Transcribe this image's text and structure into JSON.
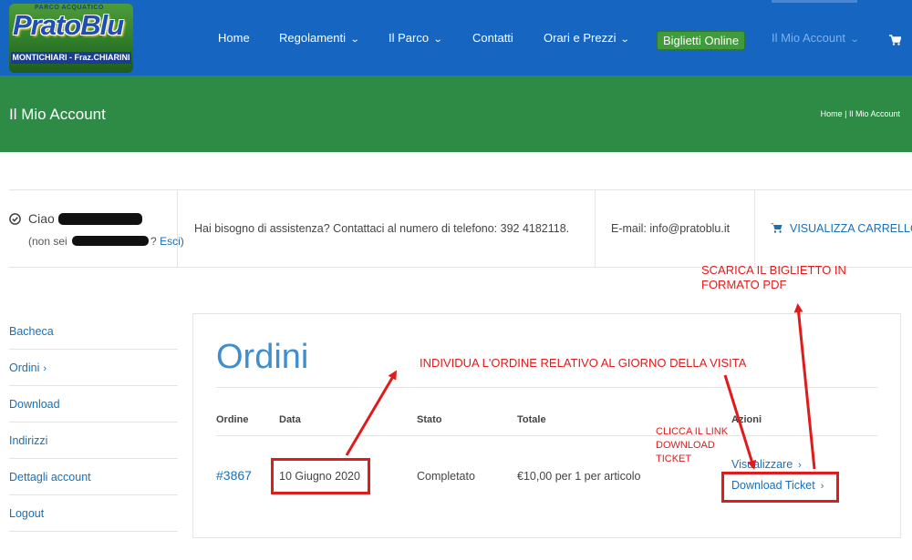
{
  "brand": {
    "logo_small": "PARCO ACQUATICO",
    "logo_main": "PratoBlu",
    "logo_band": "MONTICHIARI - Fraz.CHIARINI"
  },
  "nav": {
    "home": "Home",
    "regolamenti": "Regolamenti",
    "parco": "Il Parco",
    "contatti": "Contatti",
    "orari": "Orari e Prezzi",
    "biglietti": "Biglietti Online",
    "account": "Il Mio Account",
    "cart_icon": "shopping-cart-icon"
  },
  "title_band": {
    "title": "Il Mio Account",
    "breadcrumb": "Home  |  Il Mio Account"
  },
  "info": {
    "greeting": "Ciao",
    "not_you_prefix": "(non sei",
    "not_you_suffix": "?",
    "logout_link": "Esci",
    "not_you_close": ")",
    "assist": "Hai bisogno di assistenza? Contattaci al numero di telefono: 392 4182118.",
    "email": "E-mail: info@pratoblu.it",
    "cart_link": "VISUALIZZA CARRELLO"
  },
  "sidebar": {
    "items": [
      {
        "label": "Bacheca"
      },
      {
        "label": "Ordini"
      },
      {
        "label": "Download"
      },
      {
        "label": "Indirizzi"
      },
      {
        "label": "Dettagli account"
      },
      {
        "label": "Logout"
      }
    ]
  },
  "orders": {
    "title": "Ordini",
    "headers": [
      "Ordine",
      "Data",
      "Stato",
      "Totale",
      "Azioni"
    ],
    "rows": [
      {
        "order": "#3867",
        "date": "10 Giugno 2020",
        "status": "Completato",
        "total": "€10,00 per 1 per articolo",
        "action_view": "Visualizzare",
        "action_download": "Download Ticket"
      }
    ]
  },
  "annotations": {
    "pdf_line1": "SCARICA IL BIGLIETTO IN",
    "pdf_line2": "FORMATO PDF",
    "individua": "INDIVIDUA L'ORDINE RELATIVO AL GIORNO DELLA VISITA",
    "clicca_line1": "CLICCA IL LINK",
    "clicca_line2": "DOWNLOAD",
    "clicca_line3": "TICKET",
    "color": "#e01b1b"
  },
  "colors": {
    "header_blue": "#1665c1",
    "title_green": "#2e8b45",
    "link_blue": "#1a6fb5",
    "orders_title_blue": "#3f8fcf",
    "biglietti_green": "#3f9c3a"
  }
}
